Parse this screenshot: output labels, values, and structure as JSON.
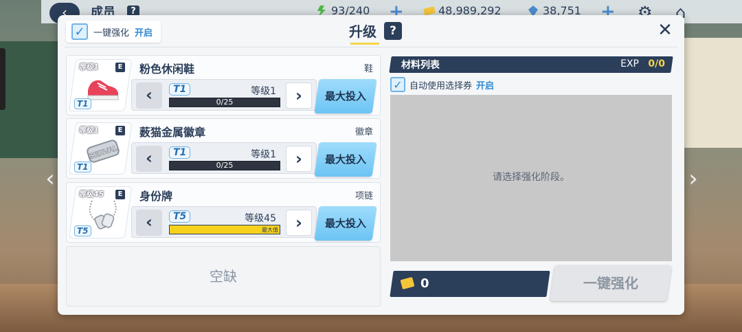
{
  "topbar": {
    "title": "成员",
    "help": "?",
    "energy": "93/240",
    "credits": "48,989,292",
    "gems": "38,751"
  },
  "header": {
    "auto_label": "一键强化",
    "auto_state": "开启",
    "title": "升级",
    "help": "?",
    "close": "✕"
  },
  "equipment": [
    {
      "name": "粉色休闲鞋",
      "type": "鞋",
      "level_tag": "等级1",
      "rank": "E",
      "tier": "T1",
      "level_text": "等级1",
      "exp": "0/25",
      "progress": 0,
      "max_label": "",
      "action": "最大投入",
      "icon": "sneaker-icon"
    },
    {
      "name": "薮猫金属徽章",
      "type": "徽章",
      "level_tag": "等级1",
      "rank": "E",
      "tier": "T1",
      "level_text": "等级1",
      "exp": "0/25",
      "progress": 0,
      "max_label": "",
      "action": "最大投入",
      "icon": "badge-icon",
      "badge_text": "SERVAL"
    },
    {
      "name": "身份牌",
      "type": "项链",
      "level_tag": "等级45",
      "rank": "E",
      "tier": "T5",
      "level_text": "等级45",
      "exp": "",
      "progress": 1,
      "max_label": "最大值",
      "action": "最大投入",
      "icon": "dogtag-icon"
    }
  ],
  "empty_slot": "空缺",
  "materials": {
    "title": "材料列表",
    "exp_label": "EXP",
    "exp_value": "0/0",
    "ticket_label": "自动使用选择券",
    "ticket_state": "开启",
    "placeholder": "请选择强化阶段。"
  },
  "footer": {
    "cost": "0",
    "upgrade_label": "一键强化"
  },
  "colors": {
    "navy": "#2b3e5a",
    "accent_blue": "#2f8ad4",
    "button_blue": "#6cc4f4",
    "progress_yellow": "#f7d21d"
  }
}
